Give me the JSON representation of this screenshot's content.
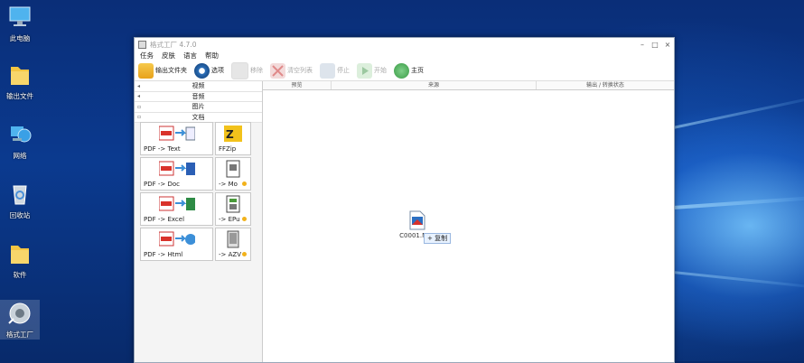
{
  "desktop": {
    "icons": [
      {
        "label": "此电脑",
        "icon": "computer-icon"
      },
      {
        "label": "输出文件",
        "icon": "folder-icon"
      },
      {
        "label": "网络",
        "icon": "network-icon"
      },
      {
        "label": "回收站",
        "icon": "recycle-bin-icon"
      },
      {
        "label": "软件",
        "icon": "folder-icon"
      },
      {
        "label": "格式工厂",
        "icon": "format-factory-icon"
      }
    ]
  },
  "window": {
    "title": "格式工厂 4.7.0",
    "controls": {
      "minimize": "–",
      "maximize": "□",
      "close": "×"
    },
    "menu": [
      "任务",
      "皮肤",
      "语言",
      "帮助"
    ],
    "toolbar": [
      {
        "label": "输出文件夹",
        "icon": "output-folder-icon",
        "enabled": true,
        "color": "#e8a21b"
      },
      {
        "label": "选项",
        "icon": "options-icon",
        "enabled": true,
        "color": "#2c6fb8"
      },
      {
        "label": "移除",
        "icon": "remove-icon",
        "enabled": false,
        "color": "#cccccc"
      },
      {
        "label": "清空列表",
        "icon": "clear-list-icon",
        "enabled": false,
        "color": "#e0a0a0"
      },
      {
        "label": "停止",
        "icon": "stop-icon",
        "enabled": false,
        "color": "#aab8c8"
      },
      {
        "label": "开始",
        "icon": "start-icon",
        "enabled": false,
        "color": "#9cc8a0"
      },
      {
        "label": "主页",
        "icon": "home-icon",
        "enabled": true,
        "color": "#3a9b45"
      }
    ],
    "categories": [
      {
        "label": "视频",
        "expander": "◂"
      },
      {
        "label": "音频",
        "expander": "◂"
      },
      {
        "label": "图片",
        "expander": "▫"
      },
      {
        "label": "文档",
        "expander": "▫"
      }
    ],
    "tiles": [
      {
        "label": "PDF -> Text",
        "icon": "pdf-to-text-icon",
        "badge": false
      },
      {
        "label": "FFZip",
        "icon": "ffzip-icon",
        "badge": false
      },
      {
        "label": "PDF -> Doc",
        "icon": "pdf-to-doc-icon",
        "badge": false
      },
      {
        "label": "-> Mo",
        "icon": "to-mobi-icon",
        "badge": true
      },
      {
        "label": "PDF -> Excel",
        "icon": "pdf-to-excel-icon",
        "badge": false
      },
      {
        "label": "-> EPu",
        "icon": "to-epub-icon",
        "badge": true
      },
      {
        "label": "PDF -> Html",
        "icon": "pdf-to-html-icon",
        "badge": false
      },
      {
        "label": "-> AZV",
        "icon": "to-azw-icon",
        "badge": true
      }
    ],
    "columns": [
      "预览",
      "来源",
      "输出 / 转换状态"
    ],
    "drag": {
      "filename": "C0001.MP4",
      "tooltip": "+ 复制"
    }
  }
}
